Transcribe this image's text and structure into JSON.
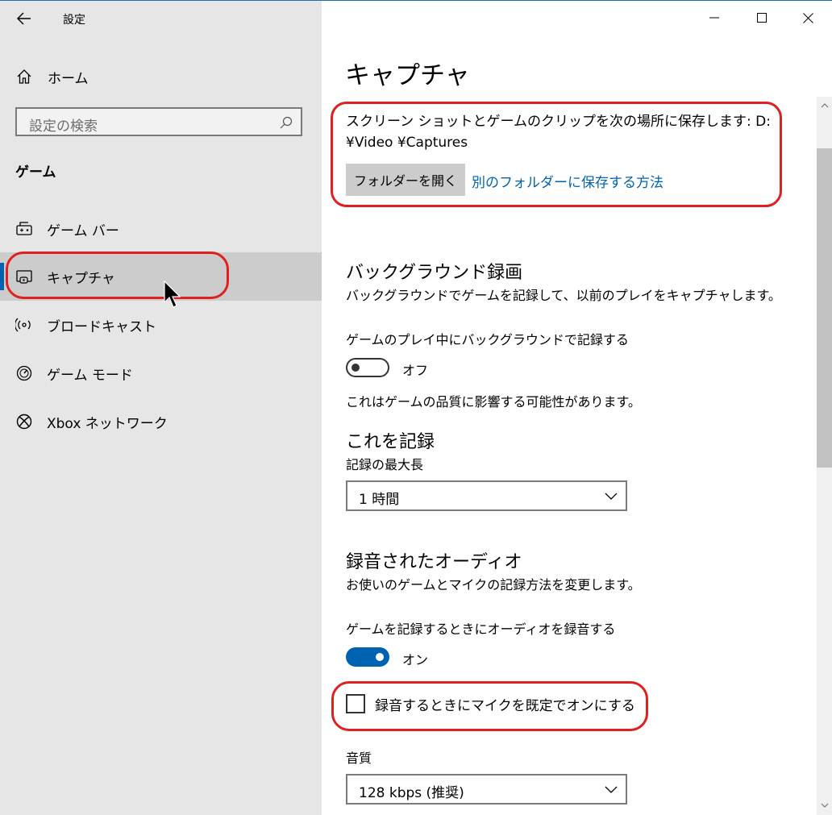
{
  "window": {
    "title": "設定",
    "minimize_icon": "minimize-icon",
    "maximize_icon": "maximize-icon",
    "close_icon": "close-icon"
  },
  "sidebar": {
    "home_label": "ホーム",
    "search_placeholder": "設定の検索",
    "section_title": "ゲーム",
    "items": [
      {
        "label": "ゲーム バー",
        "icon": "game-bar-icon"
      },
      {
        "label": "キャプチャ",
        "icon": "capture-icon",
        "selected": true
      },
      {
        "label": "ブロードキャスト",
        "icon": "broadcast-icon"
      },
      {
        "label": "ゲーム モード",
        "icon": "game-mode-icon"
      },
      {
        "label": "Xbox ネットワーク",
        "icon": "xbox-icon"
      }
    ]
  },
  "main": {
    "title": "キャプチャ",
    "save_location_text": "スクリーン ショットとゲームのクリップを次の場所に保存します: D:¥Video ¥Captures",
    "open_folder_label": "フォルダーを開く",
    "other_folder_link": "別のフォルダーに保存する方法",
    "background": {
      "heading": "バックグラウンド録画",
      "description": "バックグラウンドでゲームを記録して、以前のプレイをキャプチャします。",
      "toggle_label": "ゲームのプレイ中にバックグラウンドで記録する",
      "toggle_state": "オフ",
      "note": "これはゲームの品質に影響する可能性があります。"
    },
    "record": {
      "heading": "これを記録",
      "max_length_label": "記録の最大長",
      "max_length_value": "1 時間"
    },
    "audio": {
      "heading": "録音されたオーディオ",
      "description": "お使いのゲームとマイクの記録方法を変更します。",
      "toggle_label": "ゲームを記録するときにオーディオを録音する",
      "toggle_state": "オン",
      "mic_checkbox_label": "録音するときにマイクを既定でオンにする",
      "mic_checked": false,
      "quality_label": "音質",
      "quality_value": "128 kbps (推奨)"
    }
  },
  "colors": {
    "accent": "#0063b1",
    "annotation": "#e02020",
    "sidebar_bg": "#e6e6e6"
  }
}
